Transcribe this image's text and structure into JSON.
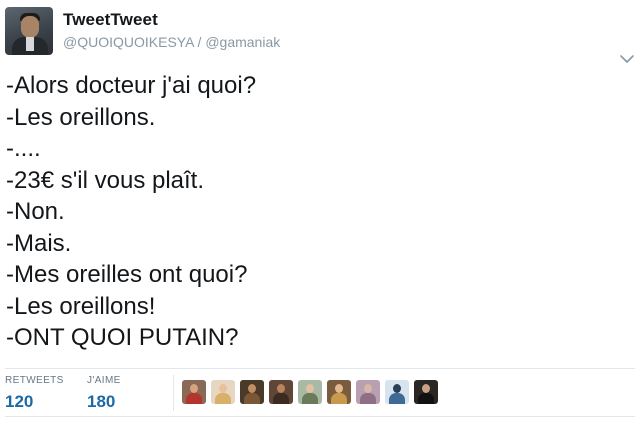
{
  "tweet": {
    "display_name": "TweetTweet",
    "handle": "@QUOIQUOIKESYA / @gamaniak",
    "lines": [
      "-Alors docteur j'ai quoi?",
      "-Les oreillons.",
      "-....",
      "-23€ s'il vous plaît.",
      "-Non.",
      "-Mais.",
      "-Mes oreilles ont quoi?",
      "-Les oreillons!",
      "-ONT QUOI PUTAIN?"
    ]
  },
  "stats": {
    "retweets_label": "RETWEETS",
    "retweets_count": "120",
    "likes_label": "J'AIME",
    "likes_count": "180"
  },
  "icons": {
    "chevron": "chevron-down-icon"
  },
  "colors": {
    "count_blue": "#1b6aa5",
    "muted_text": "#8899a6",
    "divider": "#e1e8ed"
  }
}
